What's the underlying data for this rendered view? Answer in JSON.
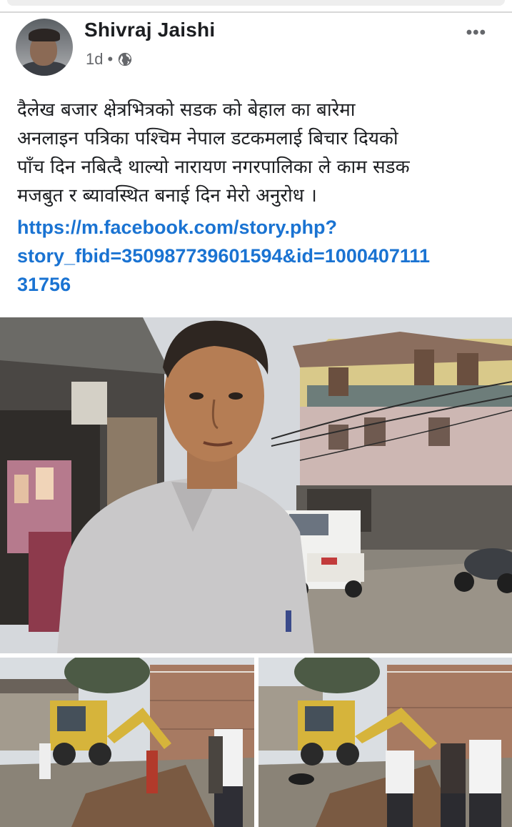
{
  "post": {
    "author": "Shivraj Jaishi",
    "time": "1d",
    "privacy_icon": "globe-icon",
    "more_icon": "more-options-icon",
    "more_label": "•••",
    "text_lines": [
      "दैलेख बजार  क्षेत्रभित्रको सडक को बेहाल का बारेमा",
      "अनलाइन पत्रिका पश्चिम नेपाल डटकमलाई बिचार दियको",
      "पाँच दिन नबित्दै थाल्यो नारायण नगरपालिका ले काम सडक",
      "मजबुत र ब्यावस्थित बनाई दिन मेरो अनुरोध ।"
    ],
    "link_lines": [
      "https://m.facebook.com/story.php?",
      "story_fbid=350987739601594&id=1000407111",
      "31756"
    ]
  },
  "colors": {
    "link": "#1a73d2",
    "text": "#1c1e21",
    "meta": "#65676b"
  }
}
